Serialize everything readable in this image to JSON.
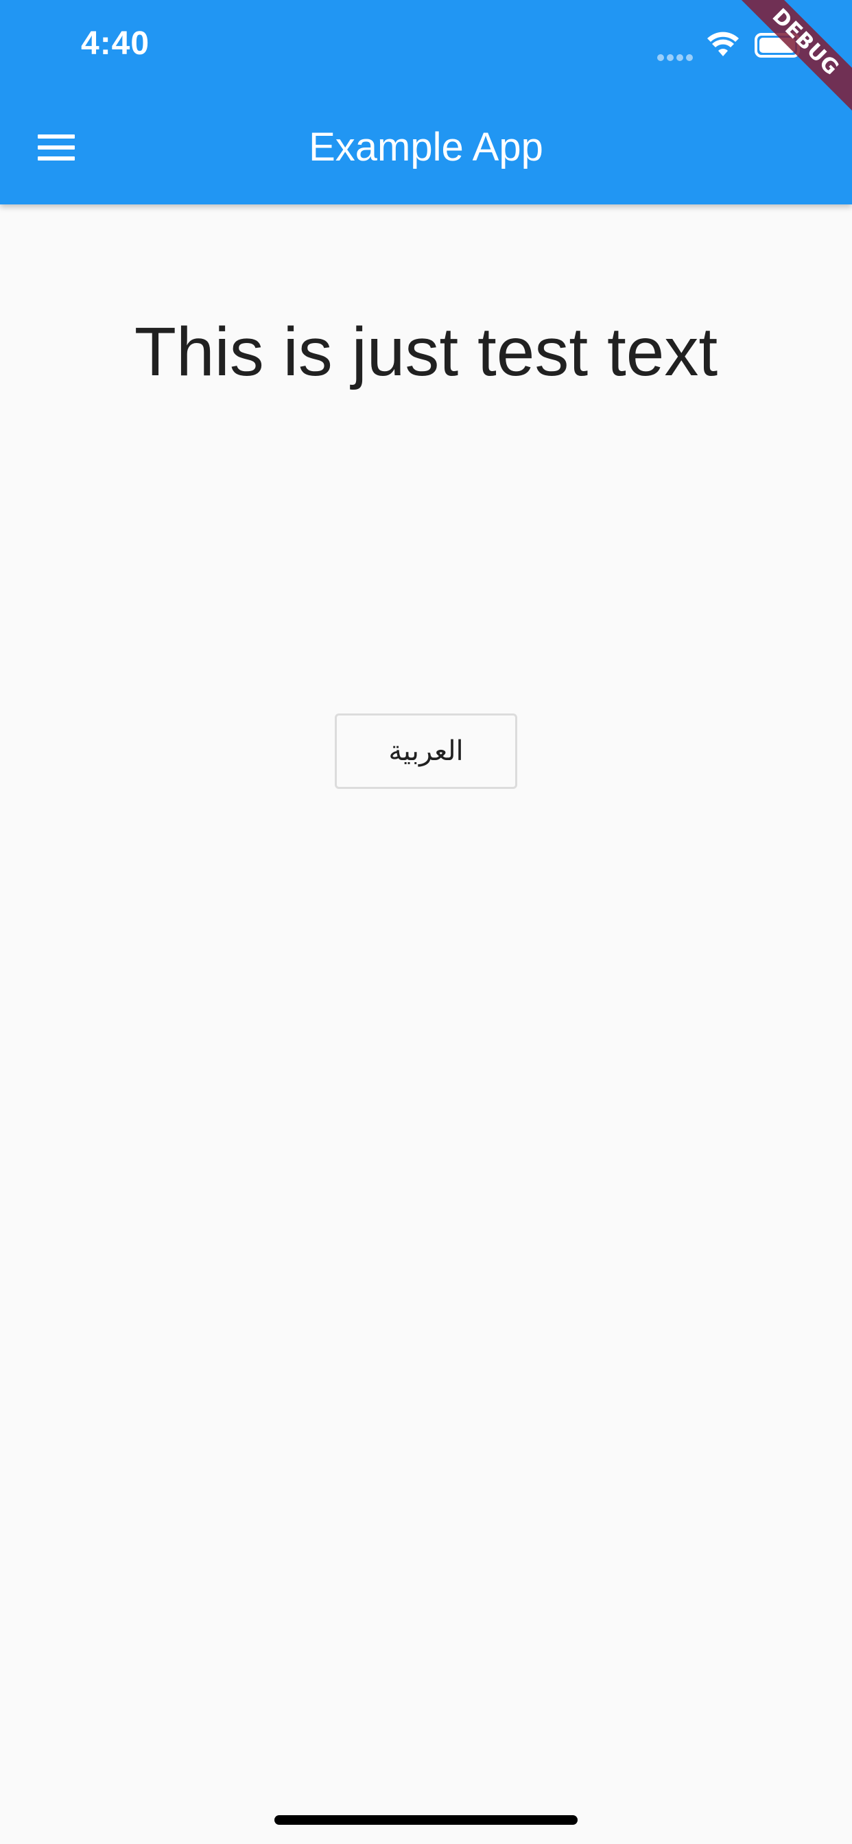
{
  "status_bar": {
    "time": "4:40"
  },
  "app_bar": {
    "title": "Example App",
    "menu_icon": "hamburger-menu-icon",
    "background_color": "#2196f3"
  },
  "debug_banner": {
    "label": "DEBUG"
  },
  "content": {
    "headline": "This is just test text",
    "language_button_label": "العربية"
  },
  "colors": {
    "primary": "#2196f3",
    "background": "#fafafa",
    "text": "#212121",
    "debug_banner": "#7e1f37"
  }
}
